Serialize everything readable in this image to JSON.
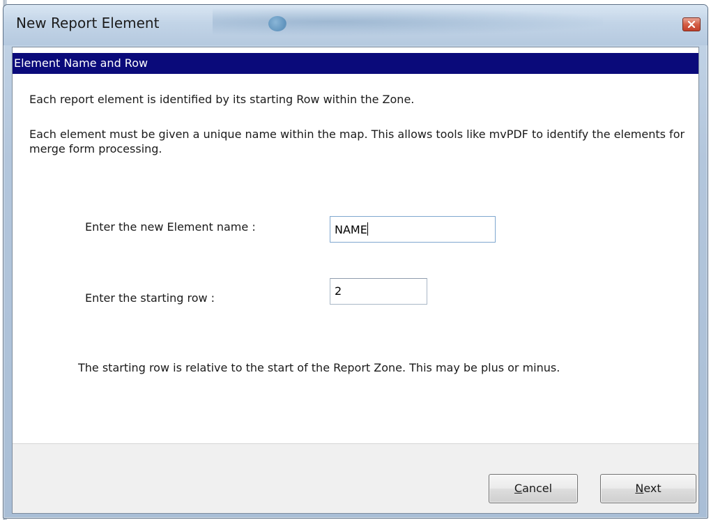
{
  "window": {
    "title": "New Report Element"
  },
  "section": {
    "header": "Element Name and Row"
  },
  "instructions": {
    "line1": "Each report element is identified by its starting Row within the Zone.",
    "line2": "Each element must be given a unique name within the map. This allows tools like mvPDF to identify the elements for merge form processing."
  },
  "form": {
    "name_label": "Enter the new Element name :",
    "name_value": "NAME",
    "row_label": "Enter the starting row :",
    "row_value": "2"
  },
  "note": "The starting row is relative to the start of the Report Zone. This may be plus or minus.",
  "buttons": {
    "cancel_mnemonic": "C",
    "cancel_rest": "ancel",
    "next_mnemonic": "N",
    "next_rest": "ext"
  },
  "icons": {
    "close": "close-icon"
  },
  "colors": {
    "section_header_bg": "#0a0a7a",
    "section_header_text": "#ffffff",
    "close_button": "#d45e45",
    "footer_bg": "#f0f0f0"
  }
}
